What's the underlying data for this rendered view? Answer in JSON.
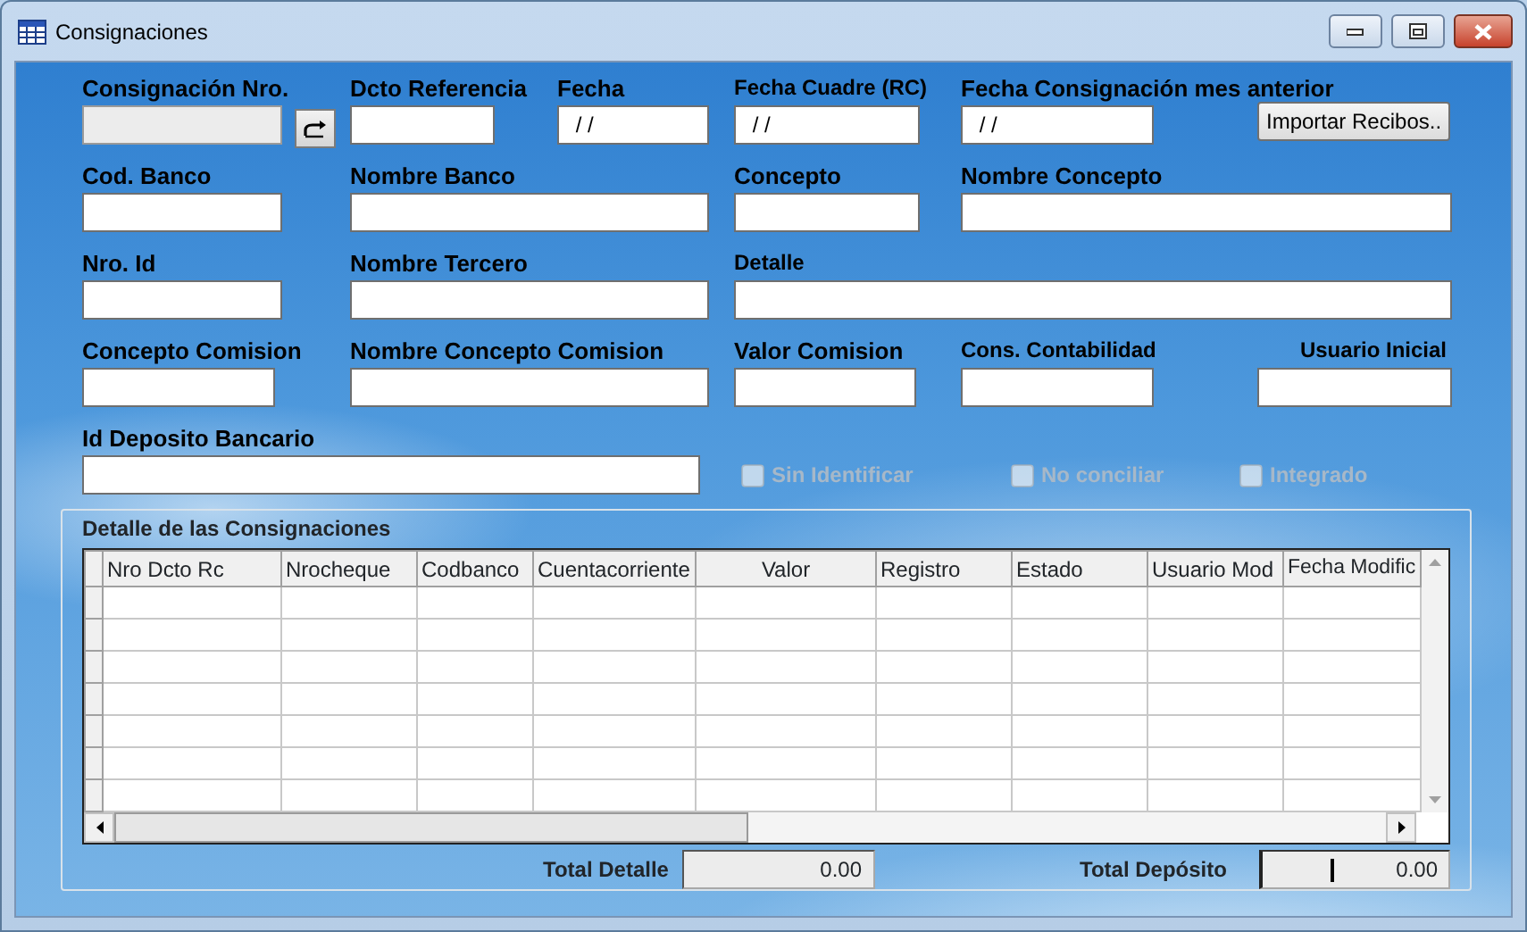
{
  "window": {
    "title": "Consignaciones"
  },
  "form_rows": [
    [
      {
        "kind": "field",
        "label": "Consignación Nro.",
        "disabled": true
      },
      {
        "kind": "icon_button"
      },
      {
        "kind": "field",
        "label": "Dcto Referencia",
        "disabled": false
      },
      {
        "kind": "field",
        "label": "Fecha",
        "value": " / /",
        "disabled": false
      },
      {
        "kind": "field",
        "label": "Fecha Cuadre (RC)",
        "value": " / /",
        "disabled": false
      },
      {
        "kind": "field",
        "label": "Fecha Consignación mes anterior",
        "value": " / /",
        "disabled": false
      },
      {
        "kind": "button",
        "label": "Importar Recibos.."
      }
    ],
    [
      {
        "kind": "field",
        "label": "Cod. Banco",
        "disabled": false
      },
      {
        "kind": "field",
        "label": "Nombre Banco",
        "disabled": false
      },
      {
        "kind": "field",
        "label": "Concepto",
        "disabled": false
      },
      {
        "kind": "field",
        "label": "Nombre Concepto",
        "disabled": false
      }
    ],
    [
      {
        "kind": "field",
        "label": "Nro. Id",
        "disabled": false
      },
      {
        "kind": "field",
        "label": "Nombre Tercero",
        "disabled": false
      },
      {
        "kind": "field",
        "label": "Detalle",
        "disabled": false
      }
    ],
    [
      {
        "kind": "field",
        "label": "Concepto Comision",
        "disabled": false
      },
      {
        "kind": "field",
        "label": "Nombre Concepto Comision",
        "disabled": false
      },
      {
        "kind": "field",
        "label": "Valor Comision",
        "disabled": false
      },
      {
        "kind": "field",
        "label": "Cons. Contabilidad",
        "disabled": false
      },
      {
        "kind": "field",
        "label": "Usuario Inicial",
        "disabled": false
      }
    ],
    [
      {
        "kind": "field",
        "label": "Id Deposito Bancario",
        "disabled": false
      },
      {
        "kind": "checkbox",
        "label": "Sin Identificar",
        "checked": false,
        "disabled": true
      },
      {
        "kind": "checkbox",
        "label": "No conciliar",
        "checked": false,
        "disabled": true
      },
      {
        "kind": "checkbox",
        "label": "Integrado",
        "checked": false,
        "disabled": true
      }
    ]
  ],
  "detail": {
    "title": "Detalle de las Consignaciones",
    "table": {
      "columns": [
        "Nro Dcto Rc",
        "Nrocheque",
        "Codbanco",
        "Cuentacorriente",
        "Valor",
        "Registro",
        "Estado",
        "Usuario Mod",
        "Fecha Modific"
      ]
    },
    "totals": [
      {
        "label": "Total Detalle",
        "value": "0.00",
        "focused": false
      },
      {
        "label": "Total Depósito",
        "value": "0.00",
        "focused": true
      }
    ]
  }
}
